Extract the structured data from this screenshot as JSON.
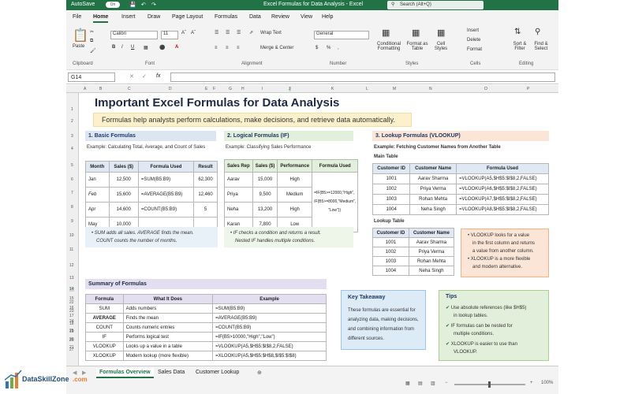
{
  "titlebar": {
    "autosave": "AutoSave",
    "toggle": "On",
    "title": "Excel Formulas for Data Analysis - Excel",
    "search": "Search (Alt+Q)"
  },
  "menu": [
    "File",
    "Home",
    "Insert",
    "Draw",
    "Page Layout",
    "Formulas",
    "Data",
    "Review",
    "View",
    "Help"
  ],
  "ribbon": {
    "paste": "Paste",
    "clipboard": "Clipboard",
    "font_name": "Calibri",
    "font_size": "11",
    "font": "Font",
    "wrap": "Wrap Text",
    "merge": "Merge & Center",
    "alignment": "Alignment",
    "numfmt": "General",
    "number": "Number",
    "cond": "Conditional Formatting",
    "fmt_table": "Format as Table",
    "cell_styles": "Cell Styles",
    "styles": "Styles",
    "insert": "Insert",
    "delete": "Delete",
    "format": "Format",
    "cells": "Cells",
    "sort": "Sort & Filter",
    "find": "Find & Select",
    "editing": "Editing"
  },
  "formula_bar": {
    "namebox": "G14",
    "fx": "fx"
  },
  "col_headers": [
    "A",
    "B",
    "C",
    "D",
    "E",
    "F",
    "G",
    "H",
    "I",
    "J",
    "K",
    "L",
    "M",
    "N",
    "O",
    "P"
  ],
  "rows": [
    "1",
    "2",
    "3",
    "4",
    "5",
    "6",
    "7",
    "8",
    "9",
    "10",
    "11",
    "12",
    "13",
    "14",
    "15",
    "16",
    "17",
    "18",
    "19",
    "20",
    "21",
    "22",
    "23",
    "24",
    "25",
    "26",
    "27"
  ],
  "title": "Important Excel Formulas for Data Analysis",
  "banner": "Formulas help analysts perform calculations, make decisions, and retrieve data automatically.",
  "s1": {
    "head": "1. Basic Formulas",
    "example": "Example: Calculating Total, Average, and Count of Sales",
    "cols": [
      "Month",
      "Sales ($)",
      "Formula Used",
      "Result"
    ],
    "rows": [
      [
        "Jan",
        "12,500",
        "=SUM(B5:B9)",
        "62,300"
      ],
      [
        "Feb",
        "15,600",
        "=AVERAGE(B5:B9)",
        "12,460"
      ],
      [
        "Apr",
        "14,600",
        "=COUNT(B5:B9)",
        "5"
      ],
      [
        "May",
        "10,000",
        "",
        ""
      ]
    ],
    "note1": "SUM adds all sales. AVERAGE finds the mean.",
    "note2": "COUNT counts the number of months."
  },
  "s2": {
    "head": "2. Logical Formulas (IF)",
    "example": "Example: Classifying Sales Performance",
    "cols": [
      "Sales Rep",
      "Sales ($)",
      "Performance",
      "Formula Used"
    ],
    "rows": [
      [
        "Aarav",
        "15,000",
        "High"
      ],
      [
        "Priya",
        "9,500",
        "Medium"
      ],
      [
        "Neha",
        "13,200",
        "High"
      ],
      [
        "Karan",
        "7,800",
        "Low"
      ]
    ],
    "formula1": "=IF(B5>=12000,\"High\",",
    "formula2": "IF(B5>=8000,\"Medium\",",
    "formula3": "\"Low\"))",
    "note1": "IF checks a condition and returns a result.",
    "note2": "Nested IF handles multiple conditions."
  },
  "s3": {
    "head": "3. Lookup Formulas (VLOOKUP)",
    "example": "Example: Fetching Customer Names from Another Table",
    "main": "Main Table",
    "cols": [
      "Customer ID",
      "Customer Name",
      "Formula Used"
    ],
    "rows": [
      [
        "1001",
        "Aarav Sharma",
        "=VLOOKUP(A5,$H$5:$I$8,2,FALSE)"
      ],
      [
        "1002",
        "Priya Verma",
        "=VLOOKUP(A6,$H$5:$I$8,2,FALSE)"
      ],
      [
        "1003",
        "Rohan Mehta",
        "=VLOOKUP(A7,$H$5:$I$8,2,FALSE)"
      ],
      [
        "1004",
        "Neha Singh",
        "=VLOOKUP(A8,$H$5:$I$8,2,FALSE)"
      ]
    ],
    "lookup": "Lookup Table",
    "lcols": [
      "Customer ID",
      "Customer Name"
    ],
    "lrows": [
      [
        "1001",
        "Aarav Sharma"
      ],
      [
        "1002",
        "Priya Verma"
      ],
      [
        "1003",
        "Rohan Mehta"
      ],
      [
        "1004",
        "Neha Singh"
      ]
    ],
    "n1": "VLOOKUP looks for a value",
    "n2": "in the first column and returns",
    "n3": "a value from another column.",
    "n4": "XLOOKUP is a more flexible",
    "n5": "and modern alternative."
  },
  "summary": {
    "head": "Summary of Formulas",
    "cols": [
      "Formula",
      "What It Does",
      "Example"
    ],
    "rows": [
      [
        "SUM",
        "Adds numbers",
        "=SUM(B5:B9)"
      ],
      [
        "AVERAGE",
        "Finds the mean",
        "=AVERAGE(B5:B9)"
      ],
      [
        "COUNT",
        "Counts numeric entries",
        "=COUNT(B5:B9)"
      ],
      [
        "IF",
        "Performs logical test",
        "=IF(B5>10000,\"High\",\"Low\")"
      ],
      [
        "VLOOKUP",
        "Looks up a value in a table",
        "=VLOOKUP(A5,$H$5:$I$8,2,FALSE)"
      ],
      [
        "XLOOKUP",
        "Modern lookup (more flexible)",
        "=XLOOKUP(A5,$H$5:$H$8,$I$5:$I$8)"
      ]
    ]
  },
  "takeaway": {
    "head": "Key Takeaway",
    "l1": "These formulas are essential for",
    "l2": "analyzing data, making decisions,",
    "l3": "and combining information from",
    "l4": "different sources."
  },
  "tips": {
    "head": "Tips",
    "t1a": "Use absolute references (like $H$5)",
    "t1b": "in lookup tables.",
    "t2a": "IF formulas can be nested for",
    "t2b": "multiple conditions.",
    "t3a": "XLOOKUP is easier to use than",
    "t3b": "VLOOKUP."
  },
  "tabs": [
    "Formulas Overview",
    "Sales Data",
    "Customer Lookup"
  ],
  "zoom": "100%",
  "brand": "DataSkillZone",
  "brand_url": ".com"
}
